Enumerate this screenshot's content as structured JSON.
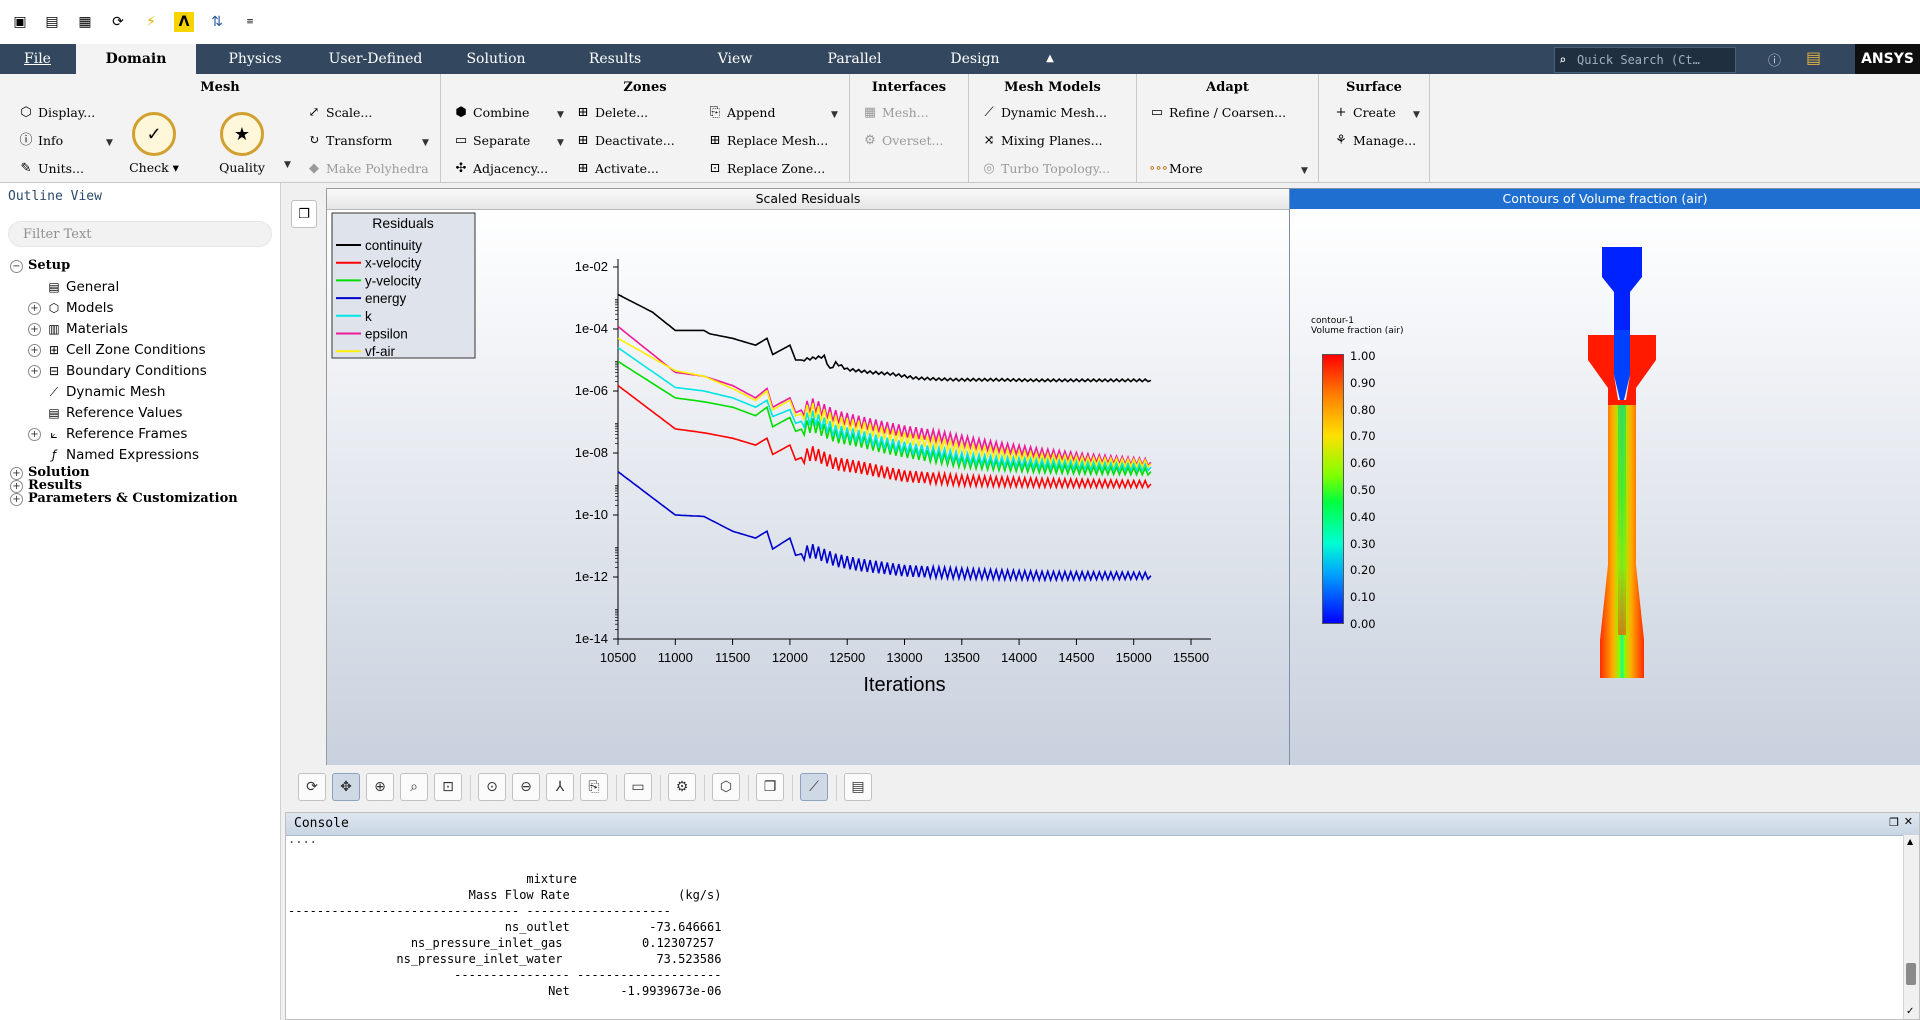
{
  "quick_access": {
    "icons": [
      "cube-icon",
      "cube-open-icon",
      "cube-save-icon",
      "reload-icon",
      "lightning-icon",
      "lambda-icon",
      "parallel-icon",
      "mdm-icon"
    ]
  },
  "tabs": [
    {
      "label": "File"
    },
    {
      "label": "Domain"
    },
    {
      "label": "Physics"
    },
    {
      "label": "User-Defined"
    },
    {
      "label": "Solution"
    },
    {
      "label": "Results"
    },
    {
      "label": "View"
    },
    {
      "label": "Parallel"
    },
    {
      "label": "Design"
    }
  ],
  "search": {
    "placeholder": "Quick Search (Ct…"
  },
  "brand": {
    "logo": "ANSYS"
  },
  "ribbon": {
    "mesh": {
      "title": "Mesh",
      "display": "Display...",
      "info": "Info",
      "units": "Units...",
      "check": "Check",
      "quality": "Quality",
      "scale": "Scale...",
      "transform": "Transform",
      "make_polyhedra": "Make Polyhedra"
    },
    "zones": {
      "title": "Zones",
      "combine": "Combine",
      "separate": "Separate",
      "adjacency": "Adjacency...",
      "delete": "Delete...",
      "deactivate": "Deactivate...",
      "activate": "Activate...",
      "append": "Append",
      "replace_mesh": "Replace Mesh...",
      "replace_zone": "Replace Zone..."
    },
    "interfaces": {
      "title": "Interfaces",
      "mesh": "Mesh...",
      "overset": "Overset..."
    },
    "mesh_models": {
      "title": "Mesh Models",
      "dynamic_mesh": "Dynamic Mesh...",
      "mixing_planes": "Mixing Planes...",
      "turbo_topology": "Turbo Topology..."
    },
    "adapt": {
      "title": "Adapt",
      "refine": "Refine / Coarsen...",
      "more": "More"
    },
    "surface": {
      "title": "Surface",
      "create": "Create",
      "manage": "Manage..."
    }
  },
  "outline": {
    "title": "Outline View",
    "filter_placeholder": "Filter Text",
    "setup": "Setup",
    "items": [
      {
        "label": "General",
        "expandable": false
      },
      {
        "label": "Models",
        "expandable": true
      },
      {
        "label": "Materials",
        "expandable": true
      },
      {
        "label": "Cell Zone Conditions",
        "expandable": true
      },
      {
        "label": "Boundary Conditions",
        "expandable": true
      },
      {
        "label": "Dynamic Mesh",
        "expandable": false
      },
      {
        "label": "Reference Values",
        "expandable": false
      },
      {
        "label": "Reference Frames",
        "expandable": true
      },
      {
        "label": "Named Expressions",
        "expandable": false
      }
    ],
    "solution": "Solution",
    "results": "Results",
    "params": "Parameters & Customization"
  },
  "residuals_panel": {
    "title": "Scaled Residuals"
  },
  "contour_panel": {
    "title": "Contours of Volume fraction (air)",
    "name": "contour-1",
    "quantity": "Volume fraction (air)",
    "levels": [
      "1.00",
      "0.90",
      "0.80",
      "0.70",
      "0.60",
      "0.50",
      "0.40",
      "0.30",
      "0.20",
      "0.10",
      "0.00"
    ]
  },
  "chart_data": {
    "type": "line",
    "legend_title": "Residuals",
    "legend_position": "top-left",
    "xlabel": "Iterations",
    "ylabel": "",
    "y_scale": "log",
    "xlim": [
      10500,
      15500
    ],
    "ylim": [
      1e-14,
      0.01
    ],
    "x_ticks": [
      "10500",
      "11000",
      "11500",
      "12000",
      "12500",
      "13000",
      "13500",
      "14000",
      "14500",
      "15000",
      "15500"
    ],
    "y_ticks": [
      "1e-02",
      "1e-04",
      "1e-06",
      "1e-08",
      "1e-10",
      "1e-12",
      "1e-14"
    ],
    "series": [
      {
        "name": "continuity",
        "color": "#000000",
        "x": [
          10500,
          10800,
          11000,
          11250,
          11300,
          11500,
          11700,
          11800,
          11850,
          12000,
          12050,
          12100,
          12300,
          12350,
          12400,
          12500,
          12700,
          12900,
          13100,
          13300,
          13500,
          13800,
          14200,
          14600,
          15000,
          15150
        ],
        "y": [
          0.0013,
          0.00035,
          9e-05,
          9e-05,
          7e-05,
          5e-05,
          3e-05,
          5e-05,
          1.5e-05,
          3e-05,
          1e-05,
          1e-05,
          1.3e-05,
          5e-06,
          8e-06,
          5e-06,
          4e-06,
          3.5e-06,
          2.6e-06,
          2.4e-06,
          2.3e-06,
          2.3e-06,
          2.2e-06,
          2.2e-06,
          2.2e-06,
          2.2e-06
        ]
      },
      {
        "name": "x-velocity",
        "color": "#ff0000",
        "x": [
          10500,
          11000,
          11250,
          11500,
          11700,
          11800,
          11850,
          12000,
          12050,
          12200,
          12400,
          12600,
          12800,
          13000,
          13300,
          13500,
          13800,
          14200,
          14600,
          15000,
          15150
        ],
        "y": [
          1.5e-06,
          6e-08,
          4.5e-08,
          3e-08,
          1.8e-08,
          3e-08,
          9e-09,
          1.8e-08,
          6e-09,
          1e-08,
          4.5e-09,
          3.5e-09,
          2.5e-09,
          1.8e-09,
          1.5e-09,
          1.3e-09,
          1.2e-09,
          1.1e-09,
          1.05e-09,
          1e-09,
          1e-09
        ]
      },
      {
        "name": "y-velocity",
        "color": "#00dd00",
        "x": [
          10500,
          11000,
          11250,
          11500,
          11700,
          11800,
          11850,
          12000,
          12050,
          12200,
          12400,
          12600,
          12800,
          13000,
          13300,
          13500,
          13800,
          14200,
          14600,
          15000,
          15150
        ],
        "y": [
          9e-06,
          6e-07,
          4.5e-07,
          3e-07,
          1.6e-07,
          3e-07,
          7e-08,
          1.4e-07,
          5e-08,
          8e-08,
          3.5e-08,
          2.5e-08,
          1.6e-08,
          1.1e-08,
          7e-09,
          5e-09,
          4e-09,
          3.2e-09,
          2.8e-09,
          2.6e-09,
          2.5e-09
        ]
      },
      {
        "name": "energy",
        "color": "#0000cc",
        "x": [
          10500,
          11000,
          11250,
          11500,
          11700,
          11800,
          11850,
          12000,
          12050,
          12200,
          12400,
          12600,
          12800,
          13000,
          13300,
          13500,
          13800,
          14200,
          14600,
          15000,
          15150
        ],
        "y": [
          2.5e-09,
          1e-10,
          9e-11,
          3e-11,
          1.8e-11,
          3e-11,
          8e-12,
          1.8e-11,
          5e-12,
          7e-12,
          3.5e-12,
          2.5e-12,
          2e-12,
          1.6e-12,
          1.4e-12,
          1.3e-12,
          1.2e-12,
          1.1e-12,
          1.1e-12,
          1.1e-12,
          1.1e-12
        ]
      },
      {
        "name": "k",
        "color": "#00e5e5",
        "x": [
          10500,
          11000,
          11250,
          11500,
          11700,
          11800,
          11850,
          12000,
          12050,
          12200,
          12400,
          12600,
          12800,
          13000,
          13300,
          13500,
          13800,
          14200,
          14600,
          15000,
          15150
        ],
        "y": [
          2.5e-05,
          1.3e-06,
          1e-06,
          6e-07,
          3e-07,
          5e-07,
          1.5e-07,
          2.5e-07,
          9e-08,
          1.4e-07,
          5e-08,
          3.5e-08,
          2.2e-08,
          1.5e-08,
          1e-08,
          7e-09,
          5.5e-09,
          4.5e-09,
          4e-09,
          3.6e-09,
          3.5e-09
        ]
      },
      {
        "name": "epsilon",
        "color": "#ee1a9a",
        "x": [
          10500,
          11000,
          11250,
          11500,
          11700,
          11800,
          11850,
          12000,
          12050,
          12200,
          12400,
          12600,
          12800,
          13000,
          13300,
          13500,
          13800,
          14200,
          14600,
          15000,
          15150
        ],
        "y": [
          0.00012,
          4e-06,
          3e-06,
          1.5e-06,
          6e-07,
          1.2e-06,
          3e-07,
          6e-07,
          2e-07,
          3.5e-07,
          1.5e-07,
          1e-07,
          7e-08,
          5e-08,
          3.5e-08,
          2.5e-08,
          1.6e-08,
          1e-08,
          7e-09,
          5.5e-09,
          5e-09
        ]
      },
      {
        "name": "vf-air",
        "color": "#ffee00",
        "x": [
          10500,
          11000,
          11250,
          11500,
          11700,
          11800,
          11850,
          12000,
          12050,
          12200,
          12400,
          12600,
          12800,
          13000,
          13300,
          13500,
          13800,
          14200,
          14600,
          15000,
          15150
        ],
        "y": [
          5e-05,
          4.5e-06,
          3e-06,
          1.2e-06,
          5e-07,
          1e-06,
          2.5e-07,
          5e-07,
          1.6e-07,
          2.5e-07,
          1e-07,
          7e-08,
          4.5e-08,
          3e-08,
          2e-08,
          1.4e-08,
          1e-08,
          7e-09,
          5.5e-09,
          4.8e-09,
          4.5e-09
        ]
      }
    ]
  },
  "graphics_toolbar": {
    "icons": [
      "rotate-icon",
      "pan-icon",
      "zoom-in-out-icon",
      "zoom-icon",
      "zoom-box-icon",
      "fit-icon",
      "zoom-to-fit-icon",
      "axes-icon",
      "copy-icon",
      "ruler-icon",
      "view-icon",
      "isometric-icon",
      "layout-icon",
      "plot-icon",
      "notes-icon"
    ]
  },
  "console": {
    "title": "Console",
    "lines": [
      "                                 mixture",
      "                         Mass Flow Rate               (kg/s)",
      "-------------------------------- --------------------",
      "                              ns_outlet           -73.646661",
      "                 ns_pressure_inlet_gas           0.12307257",
      "               ns_pressure_inlet_water             73.523586",
      "                       ---------------- --------------------",
      "                                    Net       -1.9939673e-06"
    ]
  }
}
